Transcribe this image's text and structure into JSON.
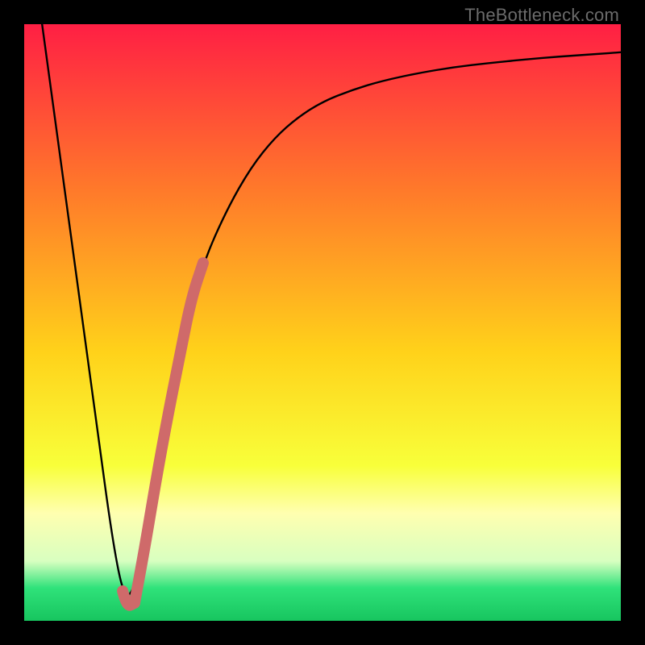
{
  "watermark": "TheBottleneck.com",
  "colors": {
    "frame": "#000000",
    "curve": "#000000",
    "pink_segment": "#cf6a6a",
    "grad_top": "#ff1f44",
    "grad_mid_upper": "#ff7a2a",
    "grad_mid": "#ffd21a",
    "grad_mid_lower": "#f8ff3a",
    "grad_pale": "#ffffb0",
    "grad_green": "#2fe27a",
    "grad_green_deep": "#17c55f"
  },
  "chart_data": {
    "type": "line",
    "title": "",
    "xlabel": "",
    "ylabel": "",
    "xlim": [
      0,
      100
    ],
    "ylim": [
      0,
      100
    ],
    "note": "Values are read off the figure in percent-of-plot coordinates. y=100 is top, y=0 is bottom. The figure has no numeric axis ticks.",
    "series": [
      {
        "name": "bottleneck-curve",
        "style": "thin-black",
        "x": [
          3,
          6,
          9,
          12,
          15,
          17,
          19,
          21,
          24,
          27,
          30,
          34,
          38,
          42,
          46,
          50,
          55,
          60,
          66,
          72,
          78,
          84,
          90,
          96,
          100
        ],
        "y": [
          100,
          78,
          56,
          34,
          12,
          3,
          7,
          18,
          34,
          49,
          60,
          69,
          76,
          81,
          84.5,
          87,
          89,
          90.5,
          91.8,
          92.8,
          93.5,
          94.1,
          94.6,
          95,
          95.3
        ]
      },
      {
        "name": "highlight-segment",
        "style": "thick-pink",
        "x": [
          18.5,
          20,
          22,
          24,
          26,
          28,
          30
        ],
        "y": [
          3,
          11,
          23,
          34,
          44,
          54,
          60
        ]
      },
      {
        "name": "highlight-hook",
        "style": "thick-pink",
        "x": [
          16.5,
          17.2,
          18.5
        ],
        "y": [
          5,
          2.3,
          3
        ]
      }
    ],
    "background_gradient_stops": [
      {
        "pos": 0.0,
        "color": "#ff1f44"
      },
      {
        "pos": 0.28,
        "color": "#ff7a2a"
      },
      {
        "pos": 0.55,
        "color": "#ffd21a"
      },
      {
        "pos": 0.74,
        "color": "#f8ff3a"
      },
      {
        "pos": 0.82,
        "color": "#ffffb0"
      },
      {
        "pos": 0.9,
        "color": "#d8ffc0"
      },
      {
        "pos": 0.945,
        "color": "#2fe27a"
      },
      {
        "pos": 1.0,
        "color": "#17c55f"
      }
    ]
  }
}
